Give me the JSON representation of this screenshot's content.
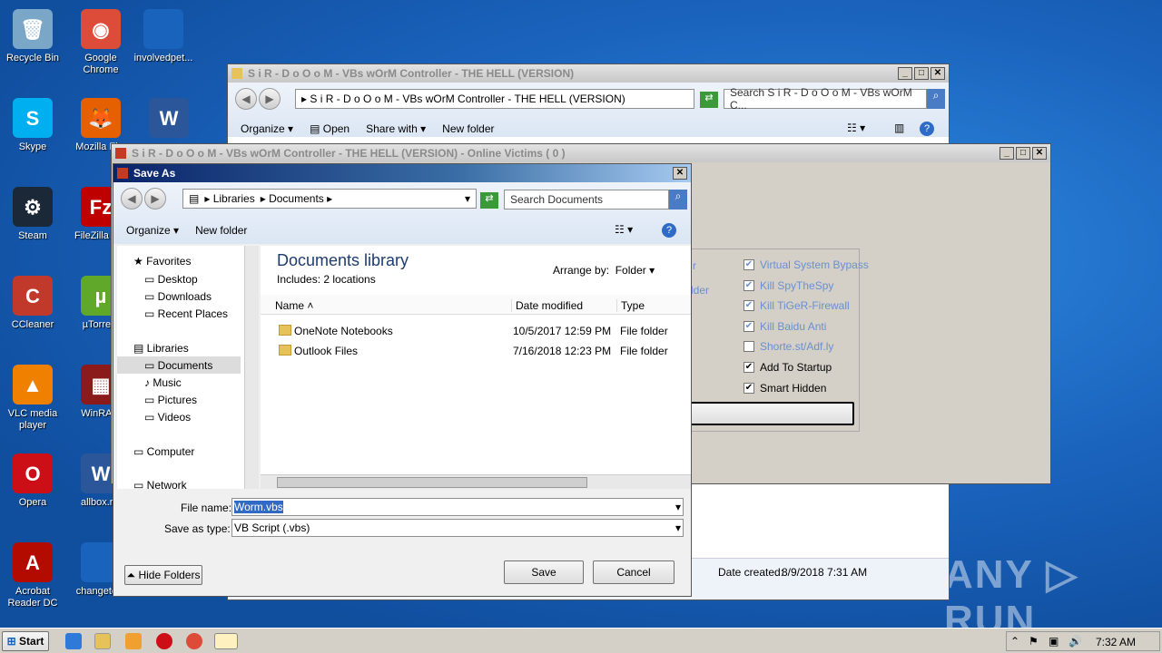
{
  "desktop": {
    "icons": [
      {
        "label": "Recycle Bin",
        "glyph": "🗑",
        "color": "#7aa6c8"
      },
      {
        "label": "Google Chrome",
        "glyph": "◉",
        "color": "#dd4b39"
      },
      {
        "label": "involvedpet...",
        "glyph": "",
        "color": "#1a63bd"
      },
      {
        "label": "Skype",
        "glyph": "S",
        "color": "#00aff0"
      },
      {
        "label": "Mozilla Fi...",
        "glyph": "🦊",
        "color": "#e66000"
      },
      {
        "label": "",
        "glyph": "W",
        "color": "#2b579a"
      },
      {
        "label": "Steam",
        "glyph": "⚙",
        "color": "#1b2838"
      },
      {
        "label": "FileZilla C...",
        "glyph": "Fz",
        "color": "#bf0000"
      },
      {
        "label": "CCleaner",
        "glyph": "C",
        "color": "#c0392b"
      },
      {
        "label": "µTorre...",
        "glyph": "µ",
        "color": "#5fa82a"
      },
      {
        "label": "VLC media player",
        "glyph": "▲",
        "color": "#f08000"
      },
      {
        "label": "WinRA...",
        "glyph": "▦",
        "color": "#8b1a1a"
      },
      {
        "label": "Opera",
        "glyph": "O",
        "color": "#cc0f16"
      },
      {
        "label": "allbox.r...",
        "glyph": "W",
        "color": "#2b579a"
      },
      {
        "label": "Acrobat Reader DC",
        "glyph": "A",
        "color": "#b30b00"
      },
      {
        "label": "changeto...",
        "glyph": "",
        "color": "#1a63bd"
      }
    ],
    "watermark": "ANY ▷ RUN"
  },
  "explorer": {
    "title": "S i R - D o O o M  - VBs wOrM Controller - THE HELL (VERSION)",
    "address": "▸ S i R - D o O o M  - VBs wOrM Controller - THE HELL (VERSION)",
    "search_placeholder": "Search S i R - D o O o M - VBs wOrM C...",
    "toolbar": {
      "organize": "Organize",
      "open": "Open",
      "share": "Share with",
      "new_folder": "New folder"
    },
    "details": {
      "label": "Date created:",
      "value": "8/9/2018 7:31 AM"
    }
  },
  "controller": {
    "title": "S i R - D o O o M  - VBs wOrM Controller - THE HELL (VERSION) - Online Victims ( 0 )",
    "partial_labels": [
      "r",
      "lder"
    ],
    "options": [
      {
        "label": "Virtual System Bypass",
        "checked": true,
        "disabled": true
      },
      {
        "label": "Kill SpyTheSpy",
        "checked": true,
        "disabled": true
      },
      {
        "label": "Kill TiGeR-Firewall",
        "checked": true,
        "disabled": true
      },
      {
        "label": "Kill Baidu Anti",
        "checked": true,
        "disabled": true
      },
      {
        "label": "Shorte.st/Adf.ly",
        "checked": false,
        "disabled": true
      },
      {
        "label": "Add To Startup",
        "checked": true,
        "disabled": false
      },
      {
        "label": "Smart Hidden",
        "checked": true,
        "disabled": false
      }
    ]
  },
  "saveas": {
    "title": "Save As",
    "breadcrumb": [
      "Libraries",
      "Documents"
    ],
    "search_placeholder": "Search Documents",
    "toolbar": {
      "organize": "Organize",
      "new_folder": "New folder"
    },
    "nav": {
      "favorites": "Favorites",
      "favorites_items": [
        "Desktop",
        "Downloads",
        "Recent Places"
      ],
      "libraries": "Libraries",
      "libraries_items": [
        "Documents",
        "Music",
        "Pictures",
        "Videos"
      ],
      "computer": "Computer",
      "network": "Network"
    },
    "library_title": "Documents library",
    "library_sub": "Includes:  2 locations",
    "arrange_label": "Arrange by:",
    "arrange_value": "Folder",
    "columns": [
      "Name",
      "Date modified",
      "Type"
    ],
    "files": [
      {
        "name": "OneNote Notebooks",
        "date": "10/5/2017 12:59 PM",
        "type": "File folder"
      },
      {
        "name": "Outlook Files",
        "date": "7/16/2018 12:23 PM",
        "type": "File folder"
      }
    ],
    "filename_label": "File name:",
    "filename_value": "Worm.vbs",
    "filetype_label": "Save as type:",
    "filetype_value": "VB Script (.vbs)",
    "hide_folders": "Hide Folders",
    "save": "Save",
    "cancel": "Cancel"
  },
  "taskbar": {
    "start": "Start",
    "time": "7:32 AM"
  }
}
